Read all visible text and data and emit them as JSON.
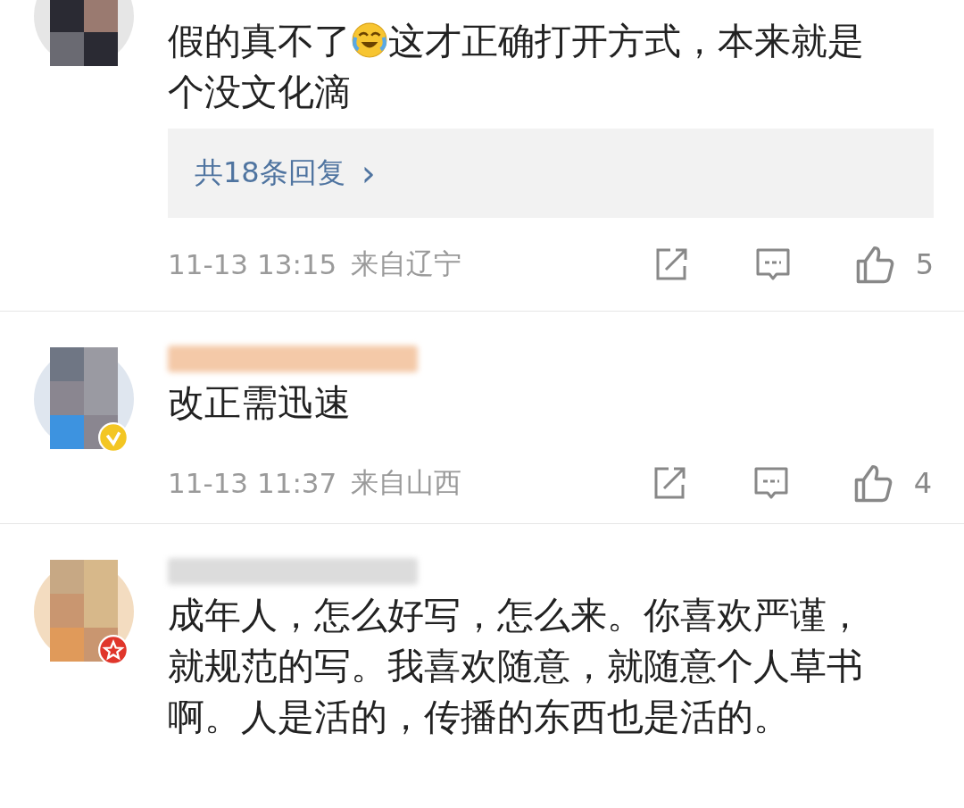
{
  "comments": [
    {
      "segments": [
        {
          "kind": "text",
          "text": "假的真不了"
        },
        {
          "kind": "emoji"
        },
        {
          "kind": "text",
          "text": "这才正确打开方式，本来就是个没文化滴"
        }
      ],
      "replies": "共18条回复",
      "reply_arrow": "›",
      "time": "11-13 13:15",
      "location": "来自辽宁",
      "likes": "5"
    },
    {
      "badge": {
        "kind": "check"
      },
      "segments": [
        {
          "kind": "text",
          "text": "改正需迅速"
        }
      ],
      "time": "11-13 11:37",
      "location": "来自山西",
      "likes": "4"
    },
    {
      "badge": {
        "kind": "star"
      },
      "segments": [
        {
          "kind": "text",
          "text": "成年人，怎么好写，怎么来。你喜欢严谨，就规范的写。我喜欢随意，就随意个人草书啊。人是活的，传播的东西也是活的。"
        }
      ]
    }
  ]
}
